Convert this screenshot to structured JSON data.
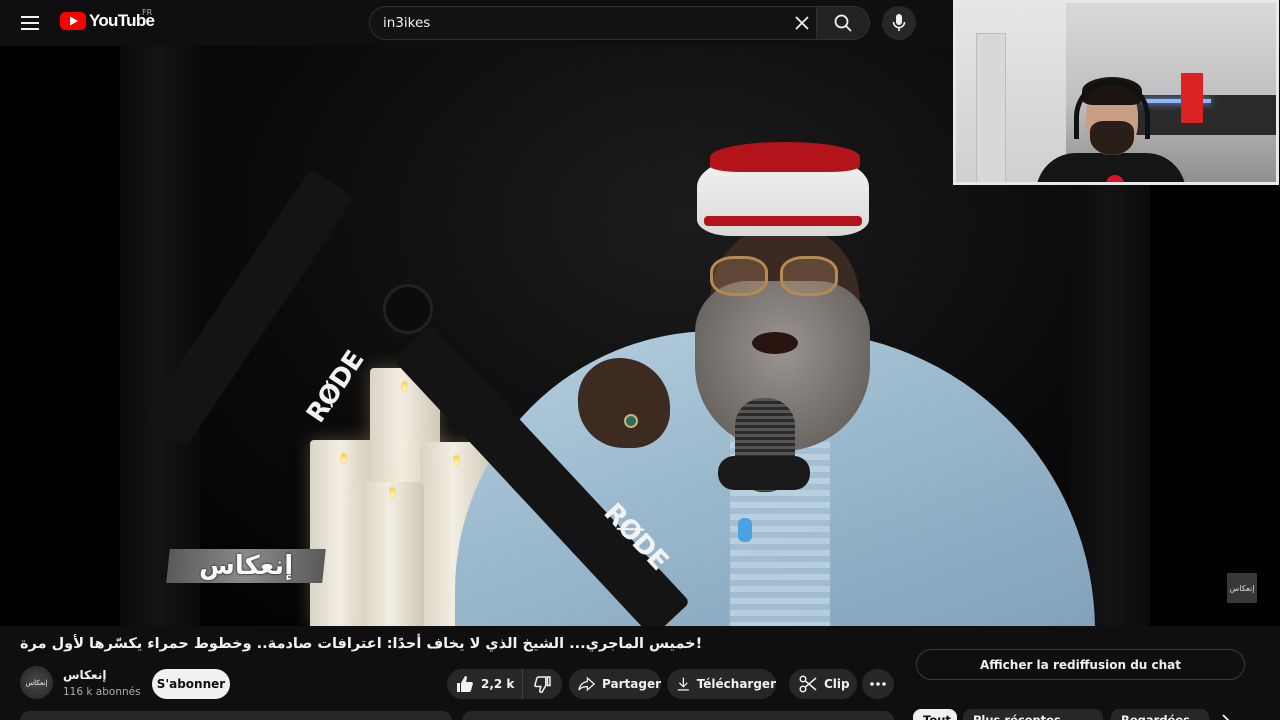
{
  "masthead": {
    "logo_text": "YouTube",
    "country_code": "FR",
    "search_value": "in3ikes",
    "icons": [
      "menu-icon",
      "youtube-logo-icon",
      "clear-icon",
      "search-icon",
      "mic-icon"
    ]
  },
  "video": {
    "overlay_logo_text": "إنعكاس",
    "corner_watermark_text": "إنعكاس",
    "mic_brand": "RØDE"
  },
  "info": {
    "title": "!خميس الماجري... الشيخ الذي لا يخاف أحدًا: اعترافات صادمة.. وخطوط حمراء يكسّرها لأول مرة",
    "channel_name": "إنعكاس",
    "avatar_text": "إنعكاس",
    "subscribers": "116 k abonnés",
    "subscribe_label": "S'abonner",
    "like_count": "2,2 k",
    "share_label": "Partager",
    "download_label": "Télécharger",
    "clip_label": "Clip",
    "chat_replay_label": "Afficher la rediffusion du chat"
  },
  "chips": [
    {
      "label": "Tout",
      "active": true
    },
    {
      "label": "Plus récentes",
      "active": false
    },
    {
      "label": "Regardées",
      "active": false
    }
  ],
  "colors": {
    "background": "#0f0f0f",
    "brand_red": "#ff0000",
    "pill": "#272727",
    "text": "#f1f1f1",
    "muted": "#aaaaaa"
  }
}
